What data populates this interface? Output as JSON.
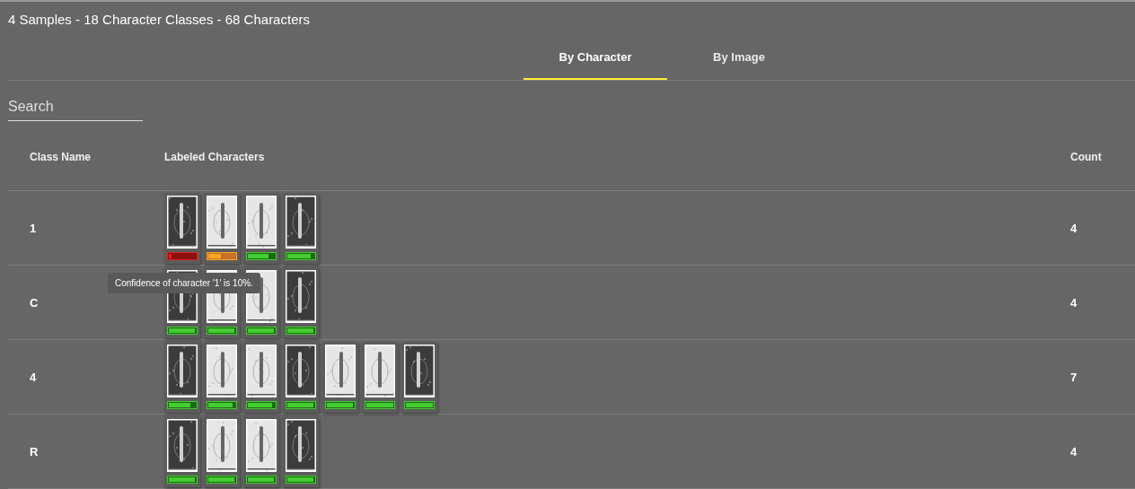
{
  "summary": "4 Samples - 18 Character Classes - 68 Characters",
  "tabs": [
    {
      "label": "By Character",
      "selected": true
    },
    {
      "label": "By Image",
      "selected": false
    }
  ],
  "search": {
    "placeholder": "Search"
  },
  "table": {
    "columns": [
      "Class Name",
      "Labeled Characters",
      "Count"
    ],
    "rows": [
      {
        "class_name": "1",
        "count": "4",
        "characters": [
          {
            "kind": "picture",
            "level": 0.1
          },
          {
            "kind": "picture",
            "level": 0.45
          },
          {
            "kind": "picture",
            "level": 0.75
          },
          {
            "kind": "picture",
            "level": 0.88
          }
        ]
      },
      {
        "class_name": "C",
        "count": "4",
        "characters": [
          {
            "kind": "picture",
            "level": 0.96
          },
          {
            "kind": "picture",
            "level": 0.96
          },
          {
            "kind": "picture",
            "level": 0.96
          },
          {
            "kind": "picture",
            "level": 0.96
          }
        ]
      },
      {
        "class_name": "4",
        "count": "7",
        "characters": [
          {
            "kind": "picture",
            "level": 0.8
          },
          {
            "kind": "picture",
            "level": 0.9
          },
          {
            "kind": "picture",
            "level": 0.9
          },
          {
            "kind": "picture",
            "level": 0.97
          },
          {
            "kind": "picture",
            "level": 0.97
          },
          {
            "kind": "picture",
            "level": 1
          },
          {
            "kind": "picture",
            "level": 1
          }
        ]
      },
      {
        "class_name": "R",
        "count": "4",
        "characters": [
          {
            "kind": "picture",
            "level": 0.97
          },
          {
            "kind": "picture",
            "level": 0.96
          },
          {
            "kind": "picture",
            "level": 0.96
          },
          {
            "kind": "picture",
            "level": 0.97
          }
        ]
      }
    ]
  },
  "tooltip": "Confidence of character '1' is 10%."
}
